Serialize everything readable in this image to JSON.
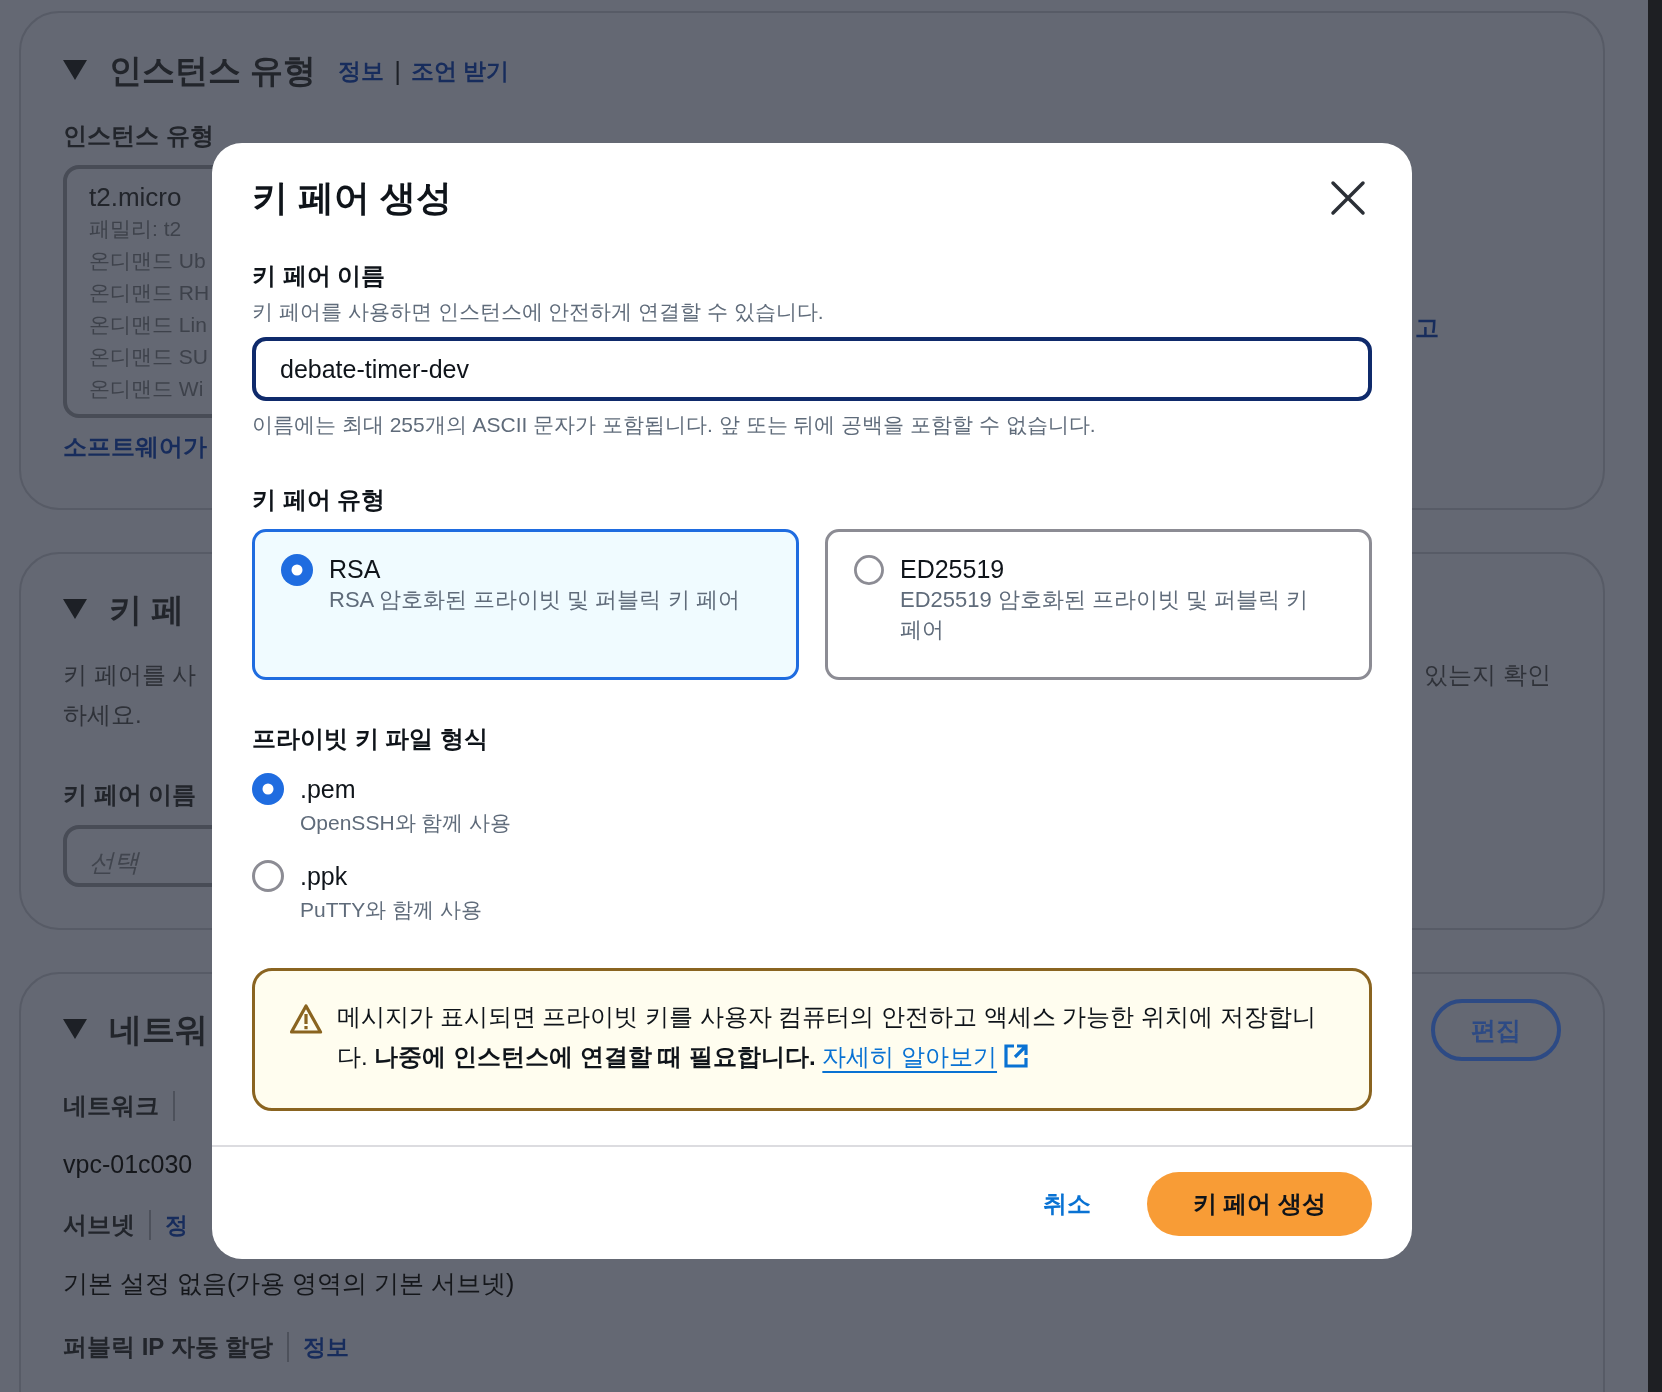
{
  "background": {
    "instance_type_section": {
      "title": "인스턴스 유형",
      "expanded": true,
      "info_link": "정보",
      "separator": "|",
      "advice_link": "조언 받기",
      "field_label": "인스턴스 유형",
      "selected_type": {
        "name": "t2.micro",
        "lines": [
          "패밀리: t2",
          "온디맨드 Ub",
          "온디맨드 RH",
          "온디맨드 Lin",
          "온디맨드 SU",
          "온디맨드 Wi"
        ]
      },
      "right_link": "고",
      "software_link": "소프트웨어가"
    },
    "key_pair_section": {
      "title": "키 페",
      "expanded": true,
      "description_lines": [
        "키 페어를 사",
        "하세요."
      ],
      "description_right": "있는지 확인",
      "field_label": "키 페어 이름",
      "select_placeholder": "선택"
    },
    "network_section": {
      "title": "네트워",
      "expanded": true,
      "edit_button": "편집",
      "fields": [
        {
          "label": "네트워크",
          "value": "vpc-01c030"
        },
        {
          "label": "서브넷",
          "info": "정",
          "value": "기본 설정 없음(가용 영역의 기본 서브넷)"
        },
        {
          "label": "퍼블릭 IP 자동 할당",
          "info": "정보"
        }
      ]
    }
  },
  "modal": {
    "title": "키 페어 생성",
    "name_field": {
      "label": "키 페어 이름",
      "description": "키 페어를 사용하면 인스턴스에 안전하게 연결할 수 있습니다.",
      "value": "debate-timer-dev",
      "focused": true,
      "hint": "이름에는 최대 255개의 ASCII 문자가 포함됩니다. 앞 또는 뒤에 공백을 포함할 수 없습니다."
    },
    "key_type": {
      "label": "키 페어 유형",
      "options": [
        {
          "title": "RSA",
          "description": "RSA 암호화된 프라이빗 및 퍼블릭 키 페어",
          "selected": true
        },
        {
          "title": "ED25519",
          "description": "ED25519 암호화된 프라이빗 및 퍼블릭 키 페어",
          "selected": false
        }
      ]
    },
    "file_format": {
      "label": "프라이빗 키 파일 형식",
      "options": [
        {
          "title": ".pem",
          "description": "OpenSSH와 함께 사용",
          "selected": true
        },
        {
          "title": ".ppk",
          "description": "PuTTY와 함께 사용",
          "selected": false
        }
      ]
    },
    "alert": {
      "text": "메시지가 표시되면 프라이빗 키를 사용자 컴퓨터의 안전하고 액세스 가능한 위치에 저장합니다. **나중에 인스턴스에 연결할 때 필요합니다.**",
      "link": "자세히 알아보기"
    },
    "buttons": [
      {
        "label": "취소",
        "kind": "link"
      },
      {
        "label": "키 페어 생성",
        "kind": "primary"
      }
    ]
  }
}
